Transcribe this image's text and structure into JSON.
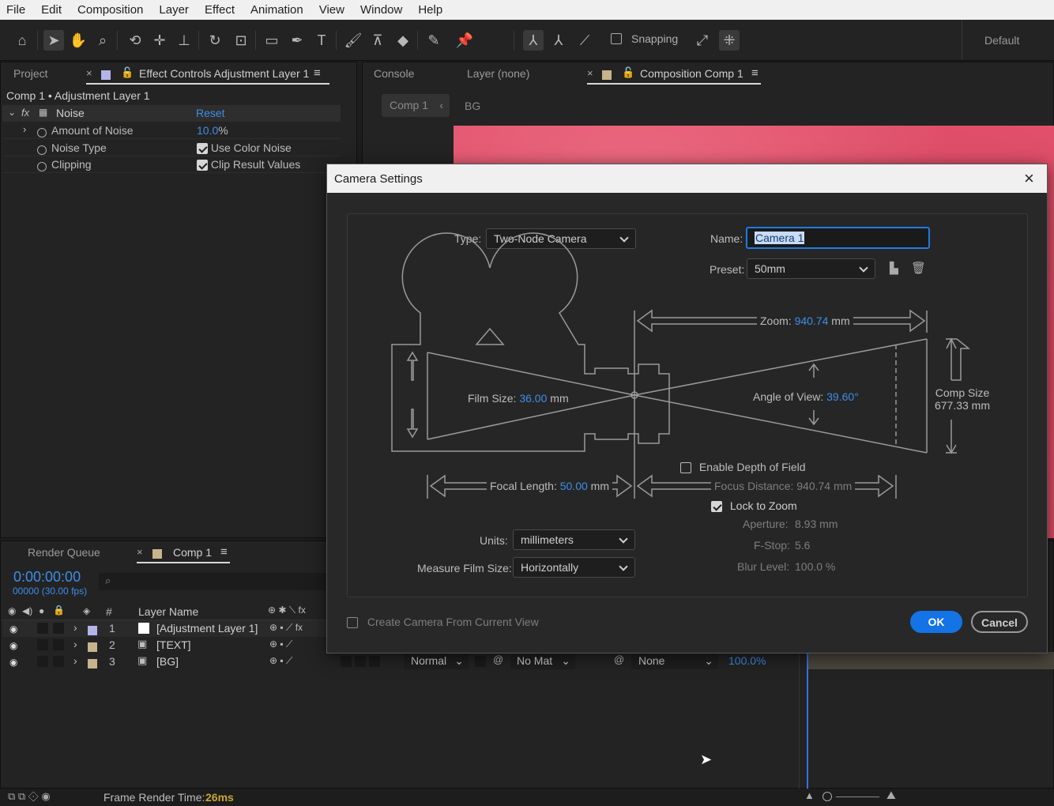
{
  "menu": [
    "File",
    "Edit",
    "Composition",
    "Layer",
    "Effect",
    "Animation",
    "View",
    "Window",
    "Help"
  ],
  "toolbar": {
    "snapping_label": "Snapping",
    "workspace": "Default"
  },
  "project_panel": {
    "tab_project": "Project",
    "tab_effect_controls": "Effect Controls Adjustment Layer 1",
    "layer_path": "Comp 1 • Adjustment Layer 1",
    "effect_name": "Noise",
    "reset_label": "Reset",
    "props": [
      {
        "name": "Amount of Noise",
        "value": "10.0",
        "unit": "%"
      },
      {
        "name": "Noise Type",
        "check_label": "Use Color Noise"
      },
      {
        "name": "Clipping",
        "check_label": "Clip Result Values"
      }
    ]
  },
  "comp_panel": {
    "tab_console": "Console",
    "tab_layer": "Layer (none)",
    "tab_comp": "Composition Comp 1",
    "crumb_comp": "Comp 1",
    "crumb_bg": "BG"
  },
  "timeline": {
    "tab_render": "Render Queue",
    "tab_comp": "Comp 1",
    "timecode": "0:00:00:00",
    "frame_info": "00000 (30.00 fps)",
    "col_num": "#",
    "col_layer_name": "Layer Name",
    "layers": [
      {
        "num": "1",
        "name": "[Adjustment Layer 1]",
        "color": "#b4b4ea"
      },
      {
        "num": "2",
        "name": "[TEXT]",
        "color": "#c8b48c"
      },
      {
        "num": "3",
        "name": "[BG]",
        "color": "#c8b48c"
      }
    ],
    "mode": "Normal",
    "trkmat": "No Mat",
    "parent": "None",
    "opacity": "100.0%",
    "render_time_label": "Frame Render Time:",
    "render_time_value": "26ms"
  },
  "dialog": {
    "title": "Camera Settings",
    "type_label": "Type:",
    "type_value": "Two-Node Camera",
    "name_label": "Name:",
    "name_value": "Camera 1",
    "preset_label": "Preset:",
    "preset_value": "50mm",
    "zoom_label": "Zoom:",
    "zoom_value": "940.74",
    "zoom_unit": "mm",
    "film_size_label": "Film Size:",
    "film_size_value": "36.00",
    "film_size_unit": "mm",
    "aov_label": "Angle of View:",
    "aov_value": "39.60",
    "aov_unit": "°",
    "comp_size_label": "Comp Size",
    "comp_size_value": "677.33 mm",
    "dof_label": "Enable Depth of Field",
    "focal_label": "Focal Length:",
    "focal_value": "50.00",
    "focal_unit": "mm",
    "focus_distance": "Focus Distance:   940.74 mm",
    "lock_zoom_label": "Lock to Zoom",
    "units_label": "Units:",
    "units_value": "millimeters",
    "measure_label": "Measure Film Size:",
    "measure_value": "Horizontally",
    "aperture_label": "Aperture:",
    "aperture_value": "8.93 mm",
    "fstop_label": "F-Stop:",
    "fstop_value": "5.6",
    "blur_label": "Blur Level:",
    "blur_value": "100.0 %",
    "create_from_view_label": "Create Camera From Current View",
    "ok_label": "OK",
    "cancel_label": "Cancel"
  },
  "colors": {
    "accent": "#1473e6",
    "value_blue": "#3d8ee8",
    "comp_bg": "#e0506a"
  }
}
